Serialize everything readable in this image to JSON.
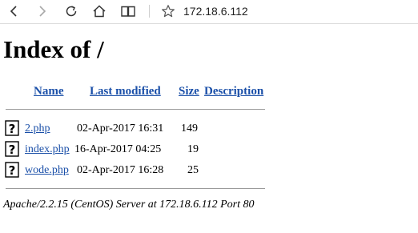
{
  "browser": {
    "url": "172.18.6.112"
  },
  "page": {
    "title": "Index of /",
    "columns": {
      "name": "Name",
      "last_modified": "Last modified",
      "size": "Size",
      "description": "Description"
    },
    "files": [
      {
        "name": "2.php",
        "modified": "02-Apr-2017 16:31",
        "size": "149",
        "description": ""
      },
      {
        "name": "index.php",
        "modified": "16-Apr-2017 04:25",
        "size": "19",
        "description": ""
      },
      {
        "name": "wode.php",
        "modified": "02-Apr-2017 16:28",
        "size": "25",
        "description": ""
      }
    ],
    "footer": "Apache/2.2.15 (CentOS) Server at 172.18.6.112 Port 80"
  },
  "icons": {
    "back": "back-arrow-icon",
    "forward": "forward-arrow-icon",
    "refresh": "refresh-icon",
    "home": "home-icon",
    "reading": "reading-view-icon",
    "favorite": "star-icon",
    "file": "unknown-file-icon"
  }
}
